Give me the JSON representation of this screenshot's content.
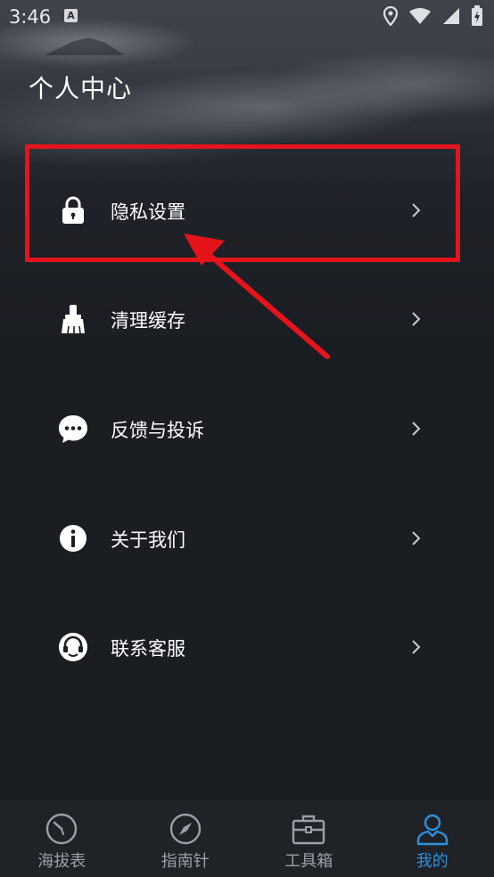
{
  "status_bar": {
    "time": "3:46",
    "app_icon_letter": "A",
    "icons": [
      "location-icon",
      "wifi-icon",
      "signal-icon",
      "battery-charging-icon"
    ]
  },
  "header": {
    "title": "个人中心"
  },
  "menu": {
    "items": [
      {
        "label": "隐私设置",
        "icon": "lock-icon",
        "highlighted": true
      },
      {
        "label": "清理缓存",
        "icon": "broom-icon"
      },
      {
        "label": "反馈与投诉",
        "icon": "chat-bubble-icon"
      },
      {
        "label": "关于我们",
        "icon": "info-icon"
      },
      {
        "label": "联系客服",
        "icon": "customer-service-icon"
      }
    ]
  },
  "bottom_nav": {
    "tabs": [
      {
        "label": "海拔表",
        "icon": "altimeter-icon",
        "active": false
      },
      {
        "label": "指南针",
        "icon": "compass-icon",
        "active": false
      },
      {
        "label": "工具箱",
        "icon": "toolbox-icon",
        "active": false
      },
      {
        "label": "我的",
        "icon": "user-icon",
        "active": true
      }
    ]
  },
  "colors": {
    "background": "#1a1d22",
    "highlight": "#e5141b",
    "active_tab": "#2f8fdc",
    "inactive_tab": "#9ba0a8"
  }
}
